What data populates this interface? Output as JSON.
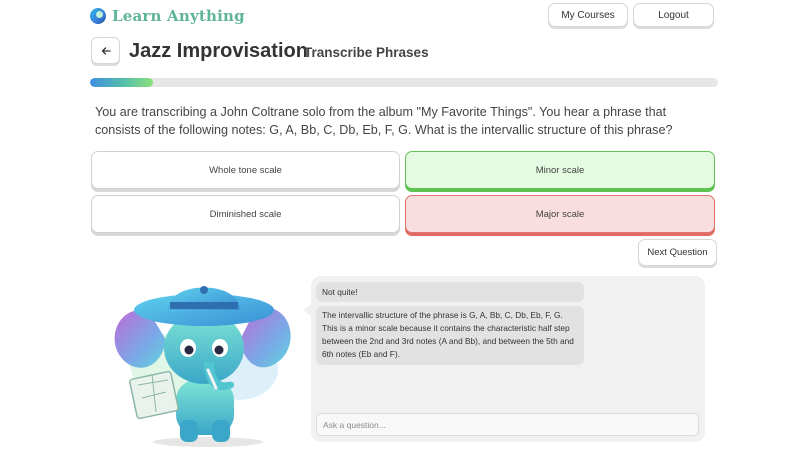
{
  "app": {
    "name": "Learn Anything",
    "brand_color": "#5fb39a"
  },
  "header": {
    "my_courses_label": "My Courses",
    "logout_label": "Logout"
  },
  "lesson": {
    "title": "Jazz Improvisation",
    "subtitle": "Transcribe Phrases",
    "back_icon": "arrow-left-icon"
  },
  "progress": {
    "fraction": 0.1
  },
  "question": {
    "text": "You are transcribing a John Coltrane solo from the album \"My Favorite Things\". You hear a phrase that consists of the following notes: G, A, Bb, C, Db, Eb, F, G. What is the intervallic structure of this phrase?"
  },
  "options": [
    {
      "label": "Whole tone scale",
      "state": "neutral"
    },
    {
      "label": "Minor scale",
      "state": "correct",
      "color": "#63c357"
    },
    {
      "label": "Diminished scale",
      "state": "neutral"
    },
    {
      "label": "Major scale",
      "state": "incorrect",
      "color": "#e0736d"
    }
  ],
  "next_button_label": "Next Question",
  "chat": {
    "messages": [
      {
        "text": "Not quite!"
      },
      {
        "text": "The intervallic structure of the phrase is G, A, Bb, C, Db, Eb, F, G. This is a minor scale because it contains the characteristic half step between the 2nd and 3rd notes (A and Bb), and between the 5th and 6th notes (Eb and F)."
      }
    ],
    "input_placeholder": "Ask a question..."
  },
  "mascot": {
    "icon": "elephant-explorer-icon"
  }
}
